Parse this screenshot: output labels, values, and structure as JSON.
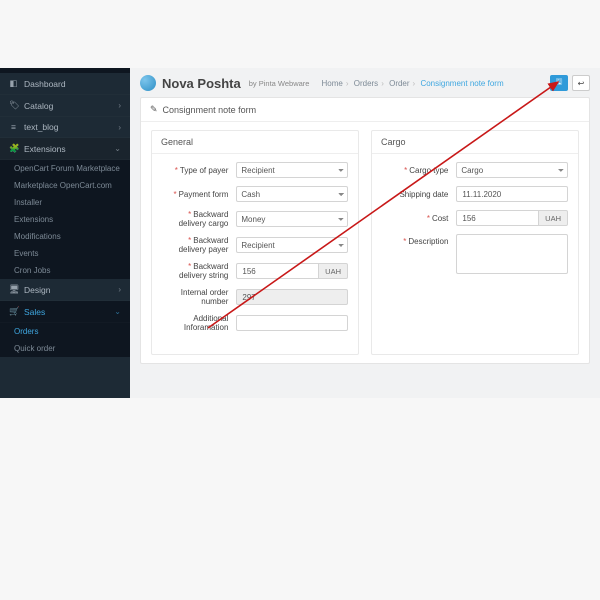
{
  "sidebar": {
    "items": [
      {
        "icon": "◧",
        "label": "Dashboard"
      },
      {
        "icon": "🏷",
        "label": "Catalog",
        "caret": true
      },
      {
        "icon": "≡",
        "label": "text_blog",
        "caret": true
      },
      {
        "icon": "🧩",
        "label": "Extensions",
        "caret": true,
        "open": true,
        "children": [
          "OpenCart Forum Marketplace",
          "Marketplace OpenCart.com",
          "Installer",
          "Extensions",
          "Modifications",
          "Events",
          "Cron Jobs"
        ]
      },
      {
        "icon": "🖥",
        "label": "Design",
        "caret": true
      },
      {
        "icon": "🛒",
        "label": "Sales",
        "caret": true,
        "active": true,
        "children": [
          "Orders",
          "Quick order"
        ]
      }
    ]
  },
  "header": {
    "title": "Nova Poshta",
    "subtitle": "by Pinta Webware",
    "breadcrumbs": [
      "Home",
      "Orders",
      "Order",
      "Consignment note form"
    ],
    "save_icon": "🖫",
    "back_icon": "↩"
  },
  "panel_title": "Consignment note form",
  "general": {
    "heading": "General",
    "type_of_payer": {
      "label": "Type of payer",
      "value": "Recipient"
    },
    "payment_form": {
      "label": "Payment form",
      "value": "Cash"
    },
    "backward_cargo": {
      "label": "Backward delivery cargo",
      "value": "Money"
    },
    "backward_payer": {
      "label": "Backward delivery payer",
      "value": "Recipient"
    },
    "backward_string": {
      "label": "Backward delivery string",
      "value": "156",
      "unit": "UAH"
    },
    "internal_order": {
      "label": "Internal order number",
      "value": "297"
    },
    "additional_info": {
      "label": "Additional Inforamation",
      "value": ""
    }
  },
  "cargo": {
    "heading": "Cargo",
    "cargo_type": {
      "label": "Cargo type",
      "value": "Cargo"
    },
    "shipping_date": {
      "label": "Shipping date",
      "value": "11.11.2020"
    },
    "cost": {
      "label": "Cost",
      "value": "156",
      "unit": "UAH"
    },
    "description": {
      "label": "Description",
      "value": ""
    }
  }
}
